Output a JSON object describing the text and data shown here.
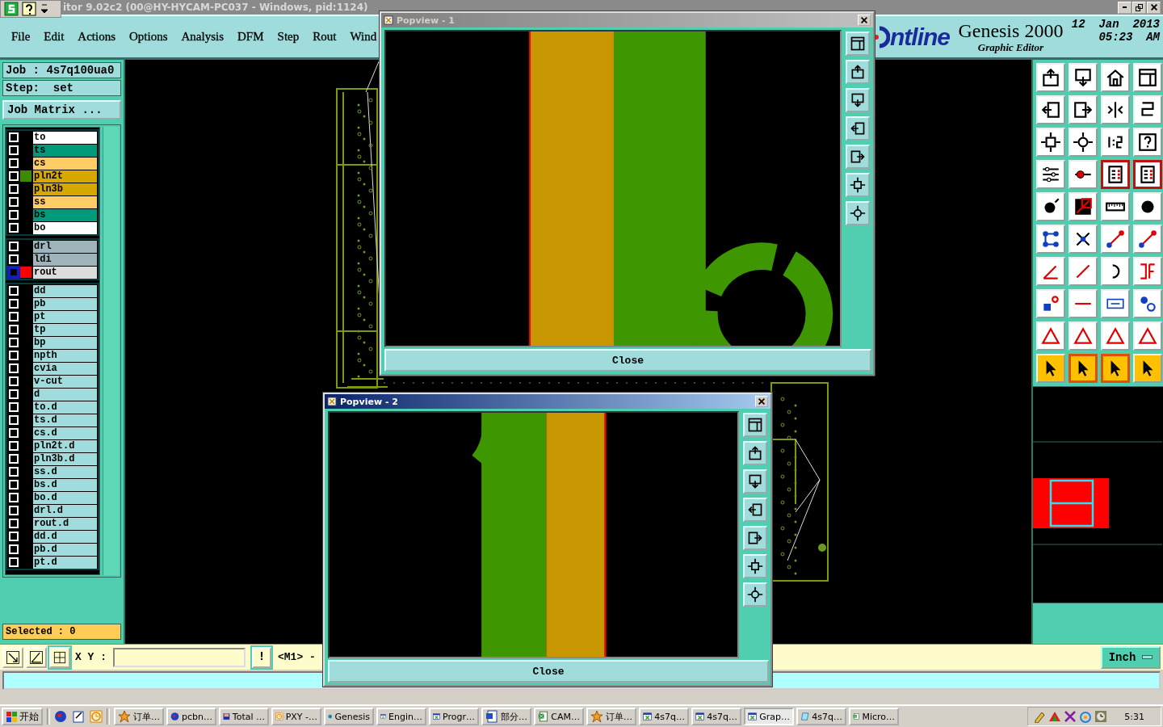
{
  "title_bar": {
    "title": "itor 9.02c2 (00@HY-HYCAM-PC037 - Windows, pid:1124)"
  },
  "menu": [
    "File",
    "Edit",
    "Actions",
    "Options",
    "Analysis",
    "DFM",
    "Step",
    "Rout",
    "Wind"
  ],
  "header": {
    "logo": "ntline",
    "product": "Genesis 2000",
    "subtitle": "Graphic Editor",
    "date": "12  Jan  2013",
    "time": "05:23  AM"
  },
  "job": {
    "job": "Job : 4s7q100ua0",
    "step": "Step:  set",
    "matrix_button": "Job Matrix ..."
  },
  "layer_groups": [
    {
      "layers": [
        {
          "name": "to",
          "color": "#ffffff",
          "checked": false,
          "focused": false
        },
        {
          "name": "ts",
          "color": "#009a7a",
          "checked": false,
          "focused": false
        },
        {
          "name": "cs",
          "color": "#ffcc66",
          "checked": false,
          "focused": false
        },
        {
          "name": "pln2t",
          "color": "#d6a800",
          "checked": false,
          "focused": false,
          "swatch": {
            "color": "#3c8c00"
          }
        },
        {
          "name": "pln3b",
          "color": "#d6a800",
          "checked": false,
          "focused": false
        },
        {
          "name": "ss",
          "color": "#ffcc66",
          "checked": false,
          "focused": false
        },
        {
          "name": "bs",
          "color": "#009a7a",
          "checked": false,
          "focused": false
        },
        {
          "name": "bo",
          "color": "#ffffff",
          "checked": false,
          "focused": false
        }
      ]
    },
    {
      "layers": [
        {
          "name": "drl",
          "color": "#a0b4bc",
          "checked": false,
          "focused": false
        },
        {
          "name": "ldi",
          "color": "#a0b4bc",
          "checked": false,
          "focused": false
        },
        {
          "name": "rout",
          "color": "#dcdcdc",
          "checked": false,
          "focused": true,
          "swatch": {
            "color": "#ff0000"
          }
        }
      ]
    },
    {
      "layers": [
        {
          "name": "dd",
          "color": "#a0dcdc",
          "checked": false,
          "focused": false
        },
        {
          "name": "pb",
          "color": "#a0dcdc",
          "checked": false,
          "focused": false
        },
        {
          "name": "pt",
          "color": "#a0dcdc",
          "checked": false,
          "focused": false
        },
        {
          "name": "tp",
          "color": "#a0dcdc",
          "checked": false,
          "focused": false
        },
        {
          "name": "bp",
          "color": "#a0dcdc",
          "checked": false,
          "focused": false
        },
        {
          "name": "npth",
          "color": "#a0dcdc",
          "checked": false,
          "focused": false
        },
        {
          "name": "cvia",
          "color": "#a0dcdc",
          "checked": false,
          "focused": false
        },
        {
          "name": "v-cut",
          "color": "#a0dcdc",
          "checked": false,
          "focused": false
        },
        {
          "name": "d",
          "color": "#a0dcdc",
          "checked": false,
          "focused": false
        },
        {
          "name": "to.d",
          "color": "#a0dcdc",
          "checked": false,
          "focused": false
        },
        {
          "name": "ts.d",
          "color": "#a0dcdc",
          "checked": false,
          "focused": false
        },
        {
          "name": "cs.d",
          "color": "#a0dcdc",
          "checked": false,
          "focused": false
        },
        {
          "name": "pln2t.d",
          "color": "#a0dcdc",
          "checked": false,
          "focused": false
        },
        {
          "name": "pln3b.d",
          "color": "#a0dcdc",
          "checked": false,
          "focused": false
        },
        {
          "name": "ss.d",
          "color": "#a0dcdc",
          "checked": false,
          "focused": false
        },
        {
          "name": "bs.d",
          "color": "#a0dcdc",
          "checked": false,
          "focused": false
        },
        {
          "name": "bo.d",
          "color": "#a0dcdc",
          "checked": false,
          "focused": false
        },
        {
          "name": "drl.d",
          "color": "#a0dcdc",
          "checked": false,
          "focused": false
        },
        {
          "name": "rout.d",
          "color": "#a0dcdc",
          "checked": false,
          "focused": false
        },
        {
          "name": "dd.d",
          "color": "#a0dcdc",
          "checked": false,
          "focused": false
        },
        {
          "name": "pb.d",
          "color": "#a0dcdc",
          "checked": false,
          "focused": false
        },
        {
          "name": "pt.d",
          "color": "#a0dcdc",
          "checked": false,
          "focused": false
        }
      ]
    }
  ],
  "selected_count": "Selected : 0",
  "toolbar": [
    {
      "kind": "up-page",
      "on": false
    },
    {
      "kind": "down-page",
      "on": false
    },
    {
      "kind": "home",
      "on": false
    },
    {
      "kind": "window",
      "on": false
    },
    {
      "kind": "left-page",
      "on": false
    },
    {
      "kind": "right-page",
      "on": false
    },
    {
      "kind": "mirror",
      "on": false
    },
    {
      "kind": "snake",
      "on": false
    },
    {
      "kind": "fit",
      "on": false
    },
    {
      "kind": "center",
      "on": false
    },
    {
      "kind": "ratio",
      "on": false
    },
    {
      "kind": "help",
      "on": false
    },
    {
      "kind": "options",
      "on": false
    },
    {
      "kind": "probe",
      "on": false
    },
    {
      "kind": "layers",
      "on": true
    },
    {
      "kind": "layers",
      "on": true
    },
    {
      "kind": "dot",
      "on": false
    },
    {
      "kind": "diagonal",
      "on": false
    },
    {
      "kind": "ruler",
      "on": false
    },
    {
      "kind": "circle",
      "on": false
    },
    {
      "kind": "nodes",
      "on": false
    },
    {
      "kind": "cross",
      "on": false
    },
    {
      "kind": "segment",
      "on": false
    },
    {
      "kind": "segment",
      "on": false
    },
    {
      "kind": "angle",
      "on": false
    },
    {
      "kind": "slash",
      "on": false
    },
    {
      "kind": "arc",
      "on": false
    },
    {
      "kind": "flip",
      "on": false
    },
    {
      "kind": "shapes",
      "on": false
    },
    {
      "kind": "dash",
      "on": false
    },
    {
      "kind": "measure",
      "on": false
    },
    {
      "kind": "chain",
      "on": false
    },
    {
      "kind": "triangle",
      "on": false
    },
    {
      "kind": "triangle",
      "on": false
    },
    {
      "kind": "triangle",
      "on": false
    },
    {
      "kind": "triangle",
      "on": false
    },
    {
      "kind": "pointer",
      "on": false
    },
    {
      "kind": "pointer",
      "on": true
    },
    {
      "kind": "pointer",
      "on": true
    },
    {
      "kind": "pointer",
      "on": false
    }
  ],
  "coords": {
    "label": "X Y :",
    "alert": "!",
    "mode": "<M1> -",
    "units": "Inch"
  },
  "popviews": [
    {
      "title": "Popview - 1",
      "active": false,
      "close": "Close"
    },
    {
      "title": "Popview - 2",
      "active": true,
      "close": "Close"
    }
  ],
  "taskbar": {
    "start": "开始",
    "tasks": [
      {
        "label": "订单…",
        "kind": "star",
        "selected": false
      },
      {
        "label": "pcbn…",
        "kind": "globe",
        "selected": false
      },
      {
        "label": "Total …",
        "kind": "disk",
        "selected": false
      },
      {
        "label": "PXY -…",
        "kind": "clock",
        "selected": false
      },
      {
        "label": "Genesis",
        "kind": "genesis",
        "selected": false
      },
      {
        "label": "Engin…",
        "kind": "window",
        "selected": false
      },
      {
        "label": "Progr…",
        "kind": "window",
        "selected": false
      },
      {
        "label": "部分…",
        "kind": "word",
        "selected": false
      },
      {
        "label": "CAM…",
        "kind": "excel",
        "selected": false
      },
      {
        "label": "订单…",
        "kind": "star",
        "selected": false
      },
      {
        "label": "4s7q…",
        "kind": "window",
        "selected": false
      },
      {
        "label": "4s7q…",
        "kind": "window",
        "selected": false
      },
      {
        "label": "Grap…",
        "kind": "window",
        "selected": true
      },
      {
        "label": "4s7q…",
        "kind": "doc",
        "selected": false
      },
      {
        "label": "Micro…",
        "kind": "excel",
        "selected": false
      }
    ],
    "clock": "5:31"
  }
}
